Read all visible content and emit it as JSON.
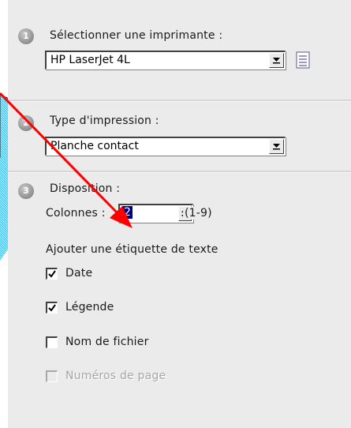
{
  "steps": [
    {
      "number": "1",
      "label": "Sélectionner une imprimante :"
    },
    {
      "number": "2",
      "label": "Type d'impression :"
    },
    {
      "number": "3",
      "label": "Disposition :"
    }
  ],
  "printer": {
    "value": "HP LaserJet 4L"
  },
  "print_type": {
    "value": "Planche contact"
  },
  "layout": {
    "columns_label": "Colonnes :",
    "columns_value": "2",
    "columns_range": "(1-9)",
    "add_text_label": "Ajouter une étiquette de texte"
  },
  "checkboxes": [
    {
      "label": "Date",
      "checked": true,
      "enabled": true
    },
    {
      "label": "Légende",
      "checked": true,
      "enabled": true
    },
    {
      "label": "Nom de fichier",
      "checked": false,
      "enabled": true
    },
    {
      "label": "Numéros de page",
      "checked": false,
      "enabled": false
    }
  ],
  "colors": {
    "panel": "#ebebeb",
    "decor_blue": "#33ccff",
    "arrow_red": "#ff0000",
    "selection": "#000080"
  },
  "icons": {
    "printer_properties": "list-icon",
    "dropdown": "chevron-down-icon",
    "spinner": "spinner-icon"
  }
}
